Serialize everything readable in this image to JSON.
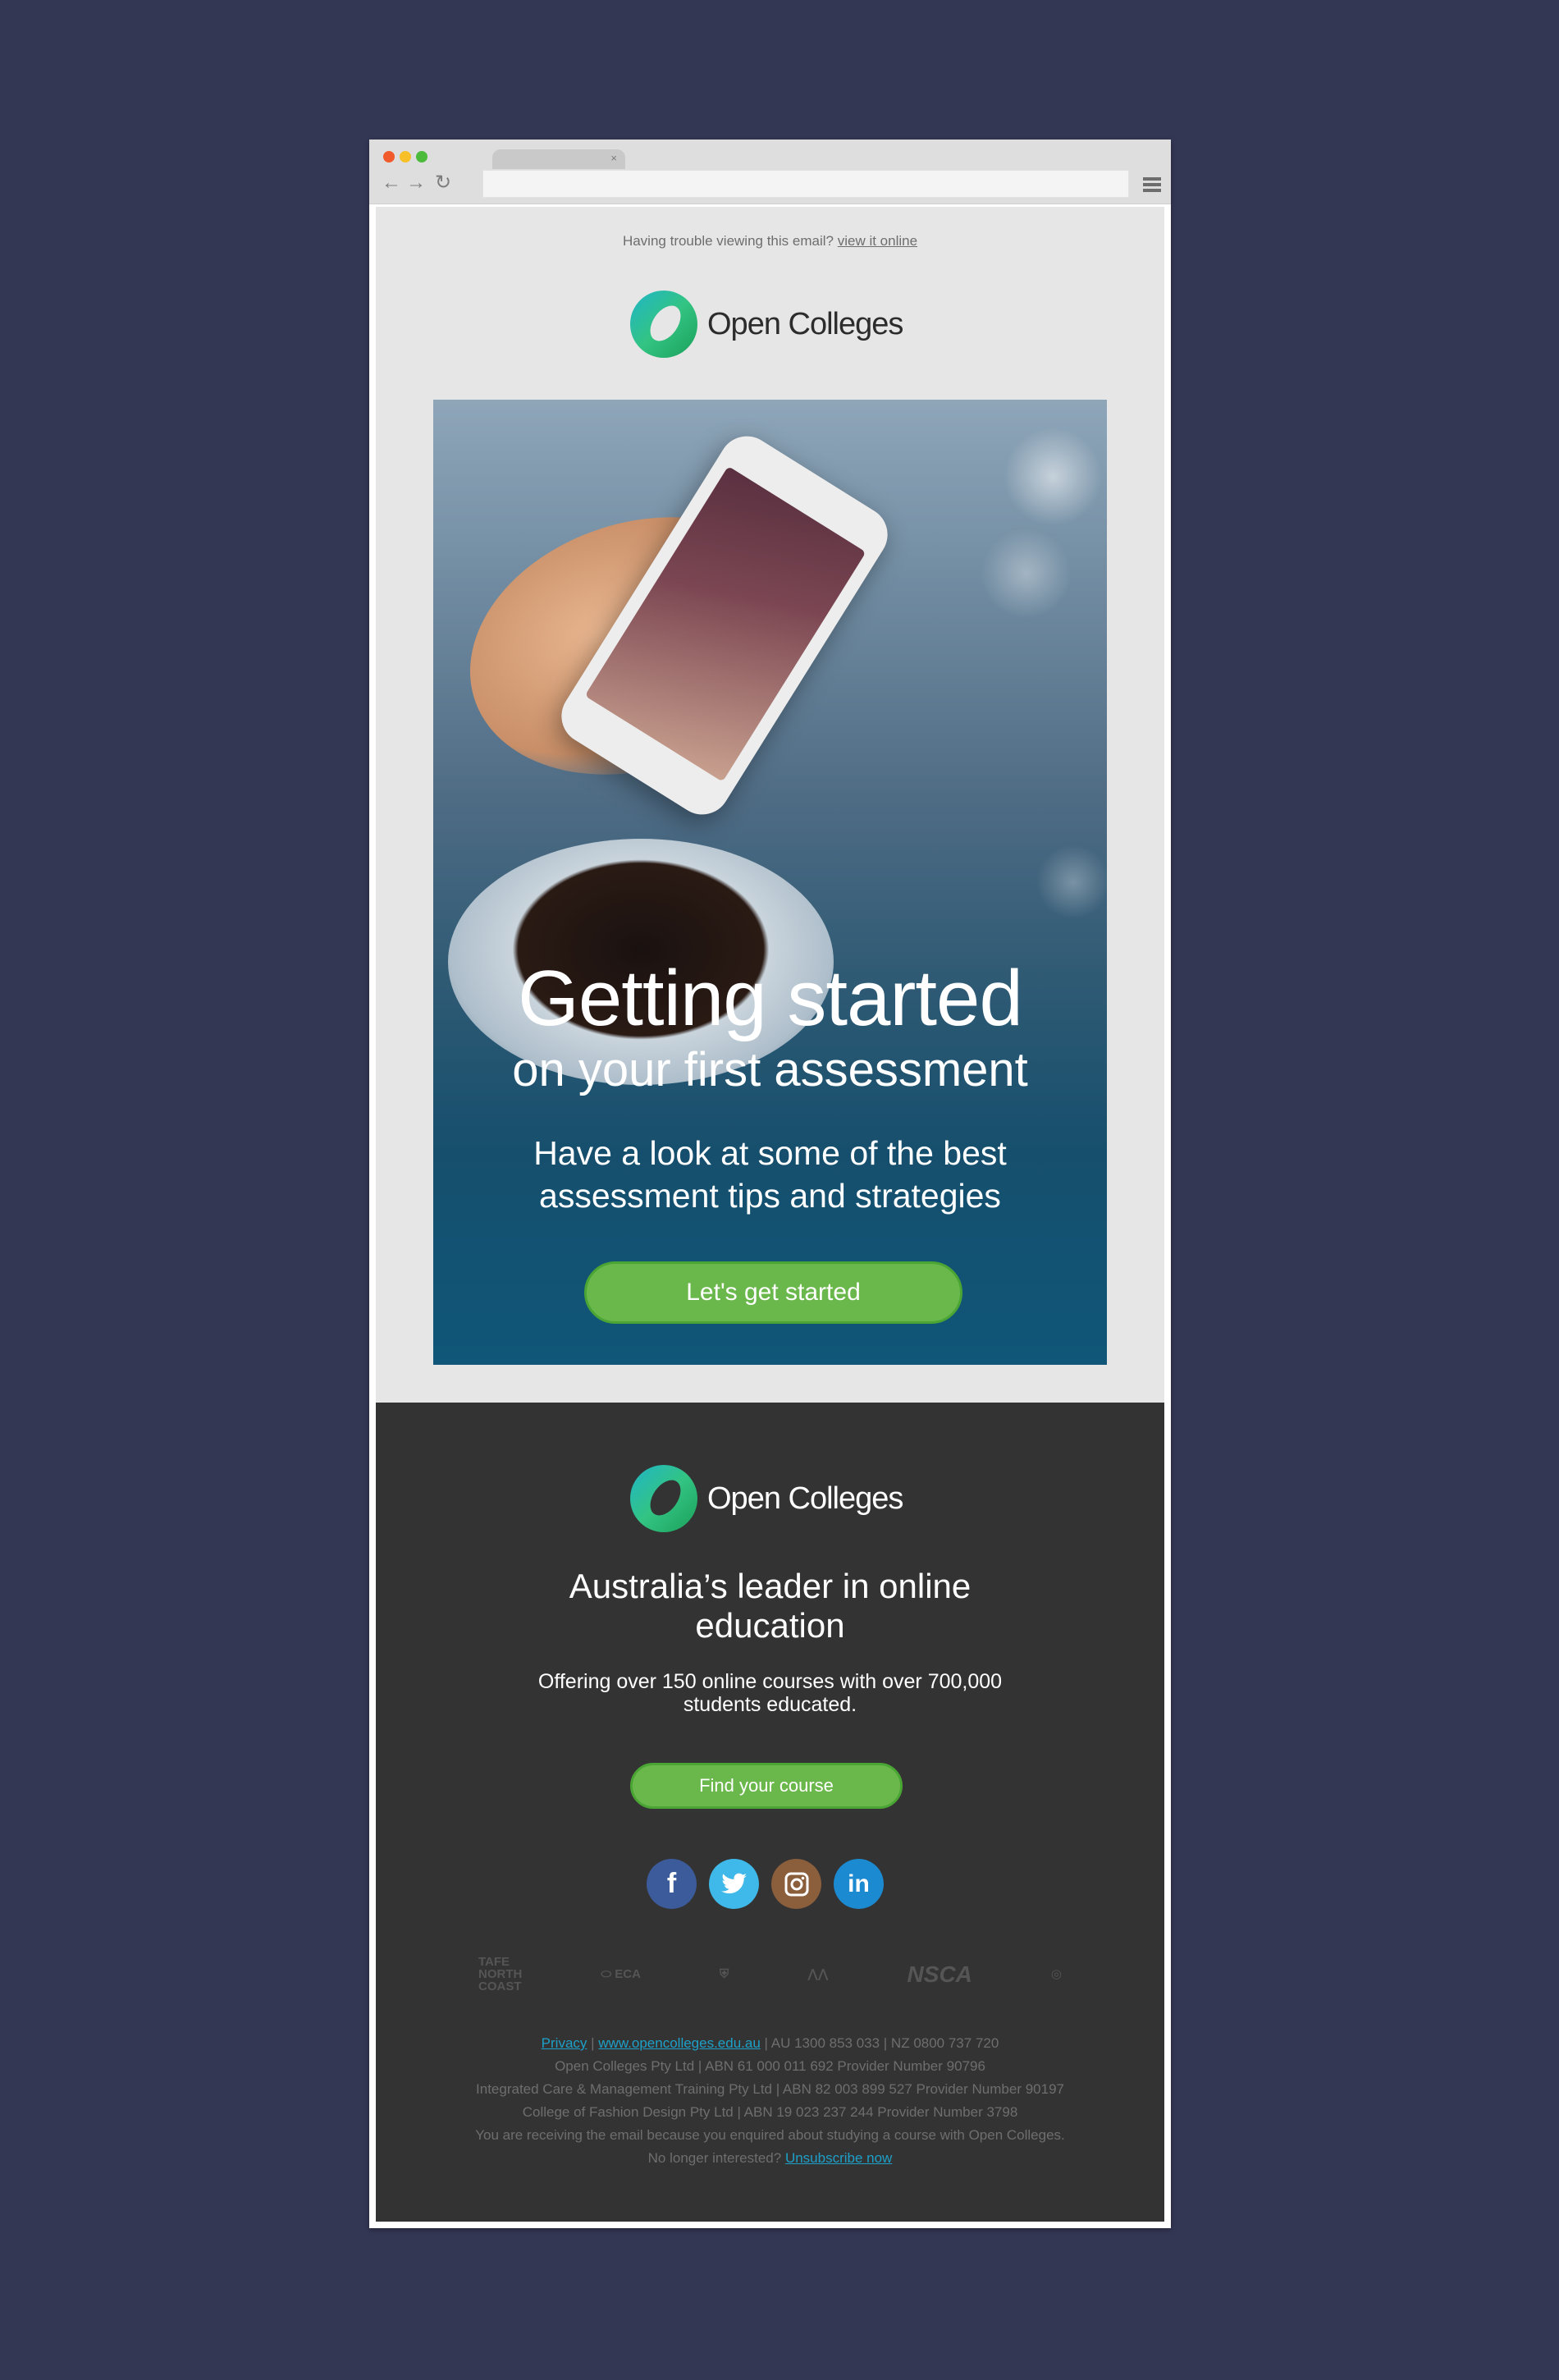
{
  "browser": {
    "tab_close": "×",
    "nav_back": "←",
    "nav_forward": "→",
    "nav_reload": "↻"
  },
  "email": {
    "preheader": {
      "text": "Having trouble viewing this email?",
      "link": "view it online"
    },
    "brand": "Open Colleges",
    "hero": {
      "title": "Getting started",
      "subtitle": "on your first assessment",
      "description": "Have a look at some of the best assessment tips and strategies",
      "cta": "Let's get started"
    },
    "footer": {
      "heading": "Australia’s leader in online education",
      "text": "Offering over 150 online courses with over 700,000 students educated.",
      "cta": "Find your course",
      "social": [
        {
          "icon": "facebook-icon",
          "glyph": "f"
        },
        {
          "icon": "twitter-icon",
          "glyph": ""
        },
        {
          "icon": "instagram-icon",
          "glyph": ""
        },
        {
          "icon": "linkedin-icon",
          "glyph": "in"
        }
      ],
      "partners": [
        "TAFE NORTH COAST INSTITUTE",
        "Early Childhood Australia",
        "Crest",
        "Australian Institute of Fitness",
        "NSCA",
        "Accreditation"
      ],
      "legal": {
        "privacy": "Privacy",
        "sep": " | ",
        "website": "www.opencolleges.edu.au",
        "phones": " | AU 1300 853 033 | NZ 0800 737 720",
        "line2": "Open Colleges Pty Ltd | ABN 61 000 011 692 Provider Number 90796",
        "line3": "Integrated Care & Management Training Pty Ltd | ABN 82 003 899 527 Provider Number 90197",
        "line4": "College of Fashion Design Pty Ltd | ABN 19 023 237 244 Provider Number 3798",
        "line5": "You are receiving the email because you enquired about studying a course with Open Colleges. No longer interested?",
        "unsubscribe": "Unsubscribe now"
      }
    }
  },
  "colors": {
    "page_bg": "#343754",
    "email_bg": "#e6e6e6",
    "footer_bg": "#333333",
    "cta_green": "#6ab84b",
    "link_blue": "#1ea0c8"
  }
}
